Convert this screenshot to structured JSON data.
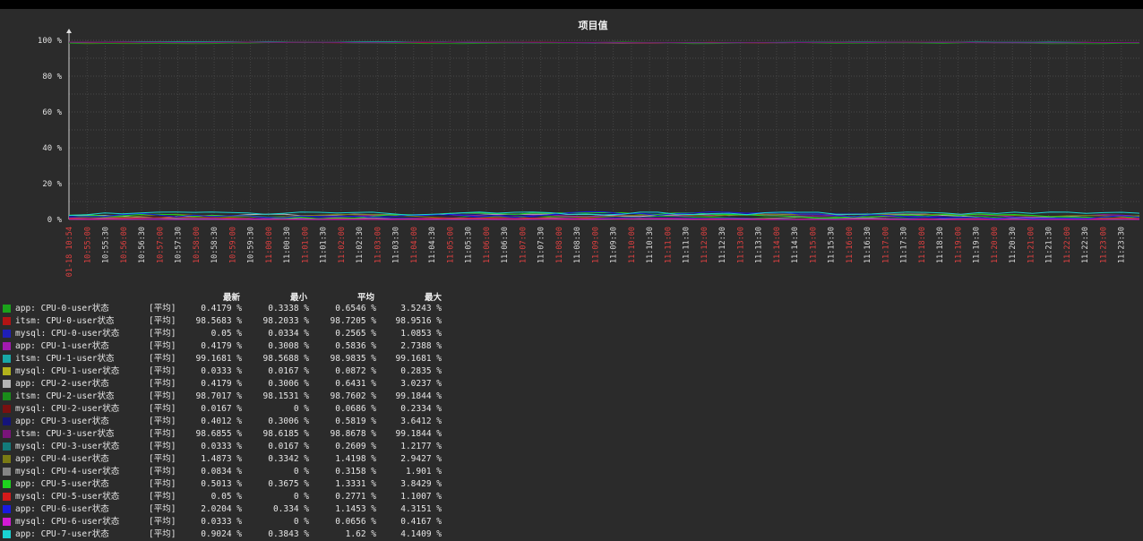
{
  "chart_data": {
    "type": "line",
    "title": "项目值",
    "y_ticks": [
      "0 %",
      "20 %",
      "40 %",
      "60 %",
      "80 %",
      "100 %"
    ],
    "ylim": [
      0,
      100
    ],
    "x_labels": [
      {
        "t": "01-18 10:54",
        "red": true
      },
      {
        "t": "10:55:00",
        "red": true
      },
      {
        "t": "10:55:30",
        "red": false
      },
      {
        "t": "10:56:00",
        "red": true
      },
      {
        "t": "10:56:30",
        "red": false
      },
      {
        "t": "10:57:00",
        "red": true
      },
      {
        "t": "10:57:30",
        "red": false
      },
      {
        "t": "10:58:00",
        "red": true
      },
      {
        "t": "10:58:30",
        "red": false
      },
      {
        "t": "10:59:00",
        "red": true
      },
      {
        "t": "10:59:30",
        "red": false
      },
      {
        "t": "11:00:00",
        "red": true
      },
      {
        "t": "11:00:30",
        "red": false
      },
      {
        "t": "11:01:00",
        "red": true
      },
      {
        "t": "11:01:30",
        "red": false
      },
      {
        "t": "11:02:00",
        "red": true
      },
      {
        "t": "11:02:30",
        "red": false
      },
      {
        "t": "11:03:00",
        "red": true
      },
      {
        "t": "11:03:30",
        "red": false
      },
      {
        "t": "11:04:00",
        "red": true
      },
      {
        "t": "11:04:30",
        "red": false
      },
      {
        "t": "11:05:00",
        "red": true
      },
      {
        "t": "11:05:30",
        "red": false
      },
      {
        "t": "11:06:00",
        "red": true
      },
      {
        "t": "11:06:30",
        "red": false
      },
      {
        "t": "11:07:00",
        "red": true
      },
      {
        "t": "11:07:30",
        "red": false
      },
      {
        "t": "11:08:00",
        "red": true
      },
      {
        "t": "11:08:30",
        "red": false
      },
      {
        "t": "11:09:00",
        "red": true
      },
      {
        "t": "11:09:30",
        "red": false
      },
      {
        "t": "11:10:00",
        "red": true
      },
      {
        "t": "11:10:30",
        "red": false
      },
      {
        "t": "11:11:00",
        "red": true
      },
      {
        "t": "11:11:30",
        "red": false
      },
      {
        "t": "11:12:00",
        "red": true
      },
      {
        "t": "11:12:30",
        "red": false
      },
      {
        "t": "11:13:00",
        "red": true
      },
      {
        "t": "11:13:30",
        "red": false
      },
      {
        "t": "11:14:00",
        "red": true
      },
      {
        "t": "11:14:30",
        "red": false
      },
      {
        "t": "11:15:00",
        "red": true
      },
      {
        "t": "11:15:30",
        "red": false
      },
      {
        "t": "11:16:00",
        "red": true
      },
      {
        "t": "11:16:30",
        "red": false
      },
      {
        "t": "11:17:00",
        "red": true
      },
      {
        "t": "11:17:30",
        "red": false
      },
      {
        "t": "11:18:00",
        "red": true
      },
      {
        "t": "11:18:30",
        "red": false
      },
      {
        "t": "11:19:00",
        "red": true
      },
      {
        "t": "11:19:30",
        "red": false
      },
      {
        "t": "11:20:00",
        "red": true
      },
      {
        "t": "11:20:30",
        "red": false
      },
      {
        "t": "11:21:00",
        "red": true
      },
      {
        "t": "11:21:30",
        "red": false
      },
      {
        "t": "11:22:00",
        "red": true
      },
      {
        "t": "11:22:30",
        "red": false
      },
      {
        "t": "11:23:00",
        "red": true
      },
      {
        "t": "11:23:30",
        "red": false
      }
    ],
    "legend_headers": {
      "last": "最新",
      "min": "最小",
      "avg": "平均",
      "max": "最大"
    },
    "series": [
      {
        "name": "app: CPU-0-user状态",
        "func": "[平均]",
        "color": "#1aa31a",
        "last": "0.4179 %",
        "min": "0.3338 %",
        "avg": "0.6546 %",
        "max": "3.5243 %",
        "lo": 0.3338,
        "hi": 3.5243
      },
      {
        "name": "itsm: CPU-0-user状态",
        "func": "[平均]",
        "color": "#b21414",
        "last": "98.5683 %",
        "min": "98.2033 %",
        "avg": "98.7205 %",
        "max": "98.9516 %",
        "lo": 98.2033,
        "hi": 98.9516
      },
      {
        "name": "mysql: CPU-0-user状态",
        "func": "[平均]",
        "color": "#1f1fb8",
        "last": "0.05 %",
        "min": "0.0334 %",
        "avg": "0.2565 %",
        "max": "1.0853 %",
        "lo": 0.0334,
        "hi": 1.0853
      },
      {
        "name": "app: CPU-1-user状态",
        "func": "[平均]",
        "color": "#a21ab0",
        "last": "0.4179 %",
        "min": "0.3008 %",
        "avg": "0.5836 %",
        "max": "2.7388 %",
        "lo": 0.3008,
        "hi": 2.7388
      },
      {
        "name": "itsm: CPU-1-user状态",
        "func": "[平均]",
        "color": "#18a8a8",
        "last": "99.1681 %",
        "min": "98.5688 %",
        "avg": "98.9835 %",
        "max": "99.1681 %",
        "lo": 98.5688,
        "hi": 99.1681
      },
      {
        "name": "mysql: CPU-1-user状态",
        "func": "[平均]",
        "color": "#b3b31c",
        "last": "0.0333 %",
        "min": "0.0167 %",
        "avg": "0.0872 %",
        "max": "0.2835 %",
        "lo": 0.0167,
        "hi": 0.2835
      },
      {
        "name": "app: CPU-2-user状态",
        "func": "[平均]",
        "color": "#b4b4b4",
        "last": "0.4179 %",
        "min": "0.3006 %",
        "avg": "0.6431 %",
        "max": "3.0237 %",
        "lo": 0.3006,
        "hi": 3.0237
      },
      {
        "name": "itsm: CPU-2-user状态",
        "func": "[平均]",
        "color": "#1a8c1a",
        "last": "98.7017 %",
        "min": "98.1531 %",
        "avg": "98.7602 %",
        "max": "99.1844 %",
        "lo": 98.1531,
        "hi": 99.1844
      },
      {
        "name": "mysql: CPU-2-user状态",
        "func": "[平均]",
        "color": "#7a1010",
        "last": "0.0167 %",
        "min": "0 %",
        "avg": "0.0686 %",
        "max": "0.2334 %",
        "lo": 0,
        "hi": 0.2334
      },
      {
        "name": "app: CPU-3-user状态",
        "func": "[平均]",
        "color": "#14147a",
        "last": "0.4012 %",
        "min": "0.3006 %",
        "avg": "0.5819 %",
        "max": "3.6412 %",
        "lo": 0.3006,
        "hi": 3.6412
      },
      {
        "name": "itsm: CPU-3-user状态",
        "func": "[平均]",
        "color": "#7a147a",
        "last": "98.6855 %",
        "min": "98.6185 %",
        "avg": "98.8678 %",
        "max": "99.1844 %",
        "lo": 98.6185,
        "hi": 99.1844
      },
      {
        "name": "mysql: CPU-3-user状态",
        "func": "[平均]",
        "color": "#137a7a",
        "last": "0.0333 %",
        "min": "0.0167 %",
        "avg": "0.2609 %",
        "max": "1.2177 %",
        "lo": 0.0167,
        "hi": 1.2177
      },
      {
        "name": "app: CPU-4-user状态",
        "func": "[平均]",
        "color": "#7a7a14",
        "last": "1.4873 %",
        "min": "0.3342 %",
        "avg": "1.4198 %",
        "max": "2.9427 %",
        "lo": 0.3342,
        "hi": 2.9427
      },
      {
        "name": "mysql: CPU-4-user状态",
        "func": "[平均]",
        "color": "#858585",
        "last": "0.0834 %",
        "min": "0 %",
        "avg": "0.3158 %",
        "max": "1.901 %",
        "lo": 0,
        "hi": 1.901
      },
      {
        "name": "app: CPU-5-user状态",
        "func": "[平均]",
        "color": "#1ed41e",
        "last": "0.5013 %",
        "min": "0.3675 %",
        "avg": "1.3331 %",
        "max": "3.8429 %",
        "lo": 0.3675,
        "hi": 3.8429
      },
      {
        "name": "mysql: CPU-5-user状态",
        "func": "[平均]",
        "color": "#d41a1a",
        "last": "0.05 %",
        "min": "0 %",
        "avg": "0.2771 %",
        "max": "1.1007 %",
        "lo": 0,
        "hi": 1.1007
      },
      {
        "name": "app: CPU-6-user状态",
        "func": "[平均]",
        "color": "#1a1ae0",
        "last": "2.0204 %",
        "min": "0.334 %",
        "avg": "1.1453 %",
        "max": "4.3151 %",
        "lo": 0.334,
        "hi": 4.3151
      },
      {
        "name": "mysql: CPU-6-user状态",
        "func": "[平均]",
        "color": "#d41ad4",
        "last": "0.0333 %",
        "min": "0 %",
        "avg": "0.0656 %",
        "max": "0.4167 %",
        "lo": 0,
        "hi": 0.4167
      },
      {
        "name": "app: CPU-7-user状态",
        "func": "[平均]",
        "color": "#1ad4d4",
        "last": "0.9024 %",
        "min": "0.3843 %",
        "avg": "1.62 %",
        "max": "4.1409 %",
        "lo": 0.3843,
        "hi": 4.1409
      }
    ]
  }
}
